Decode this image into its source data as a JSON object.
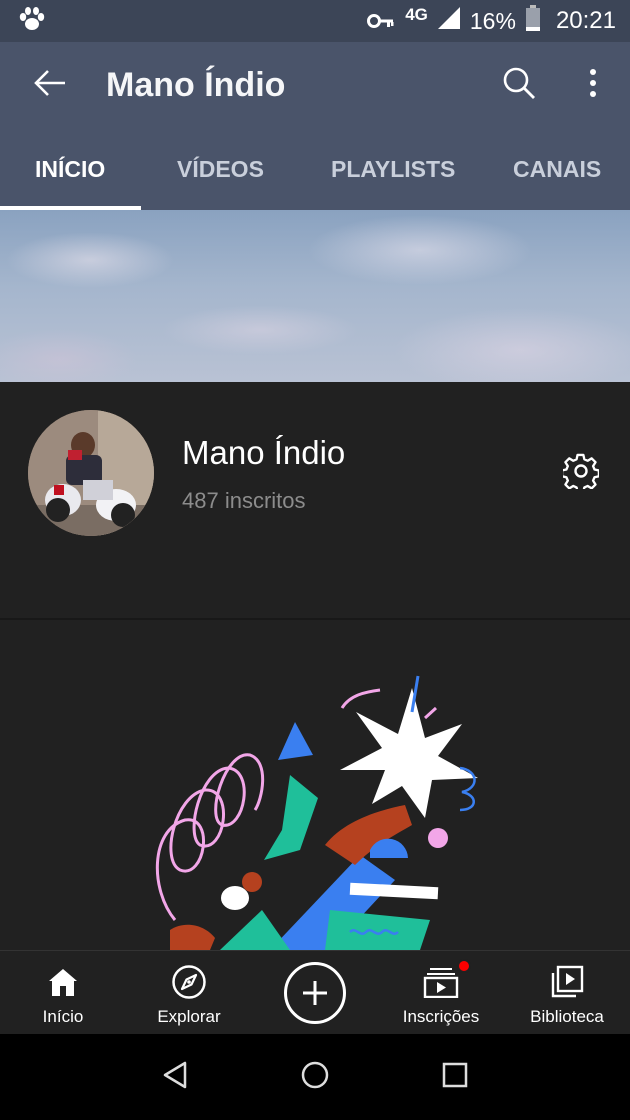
{
  "status_bar": {
    "network": "4G",
    "battery": "16%",
    "time": "20:21",
    "icons": [
      "paw-icon",
      "key-icon",
      "signal-icon",
      "battery-icon"
    ]
  },
  "app_bar": {
    "title": "Mano Índio",
    "icons": [
      "back-arrow-icon",
      "search-icon",
      "more-vertical-icon"
    ]
  },
  "tabs": [
    {
      "label": "INÍCIO",
      "active": true
    },
    {
      "label": "VÍDEOS",
      "active": false
    },
    {
      "label": "PLAYLISTS",
      "active": false
    },
    {
      "label": "CANAIS",
      "active": false
    }
  ],
  "channel": {
    "name": "Mano Índio",
    "subscribers": "487 inscritos",
    "settings_icon": "gear-icon"
  },
  "bottom_nav": [
    {
      "label": "Início",
      "icon": "home-icon"
    },
    {
      "label": "Explorar",
      "icon": "compass-icon"
    },
    {
      "label": "",
      "icon": "create-plus-icon"
    },
    {
      "label": "Inscrições",
      "icon": "subscriptions-icon",
      "badge": true
    },
    {
      "label": "Biblioteca",
      "icon": "library-icon"
    }
  ],
  "colors": {
    "status_bar_bg": "#3c4557",
    "app_bar_bg": "#4a546a",
    "surface": "#212121",
    "badge": "#ff0000",
    "illustration_green": "#1fbf9a",
    "illustration_pink": "#f2a6e8",
    "illustration_blue": "#3a7ff0",
    "illustration_brown": "#b5411f"
  }
}
